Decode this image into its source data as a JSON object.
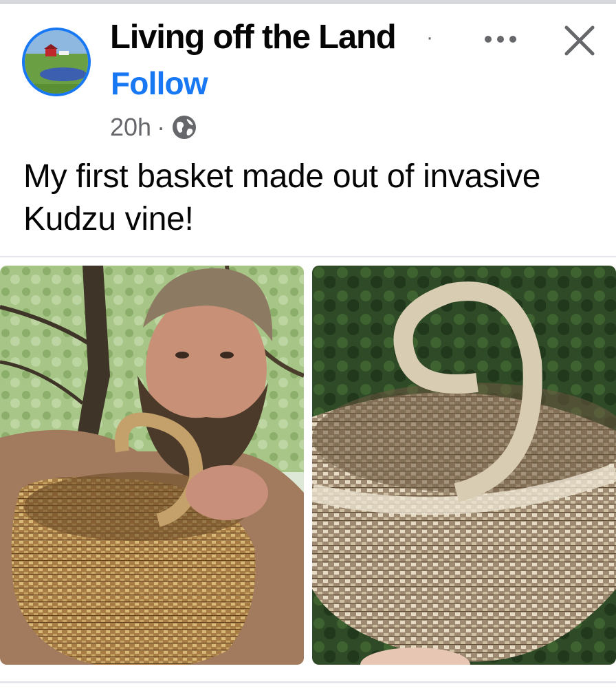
{
  "post": {
    "page_name": "Living off the Land",
    "separator": "·",
    "follow_label": "Follow",
    "time": "20h",
    "meta_separator": "·",
    "audience_icon": "globe-icon",
    "more_icon": "more-options-icon",
    "close_icon": "close-icon",
    "text": "My first basket made out of invasive Kudzu vine!",
    "photos": [
      {
        "name": "photo-man-holding-basket",
        "desc_icon": "photo"
      },
      {
        "name": "photo-basket-closeup",
        "desc_icon": "photo"
      }
    ]
  },
  "colors": {
    "brand_blue": "#1877f2",
    "secondary_text": "#65676b",
    "primary_text": "#050505",
    "divider": "#e4e6eb"
  }
}
